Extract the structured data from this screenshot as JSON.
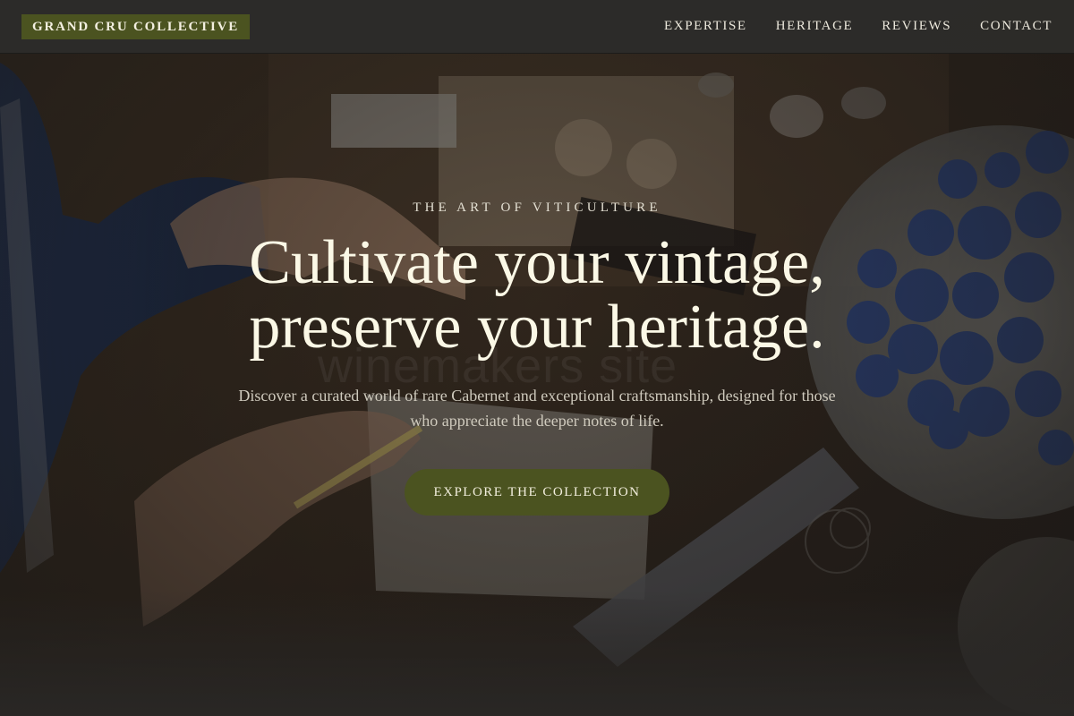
{
  "brand": {
    "logo_text": "GRAND CRU COLLECTIVE",
    "accent_color": "#4b5320"
  },
  "nav": {
    "items": [
      {
        "label": "EXPERTISE"
      },
      {
        "label": "HERITAGE"
      },
      {
        "label": "REVIEWS"
      },
      {
        "label": "CONTACT"
      }
    ]
  },
  "hero": {
    "eyebrow": "THE ART OF VITICULTURE",
    "headline_line1": "Cultivate your vintage,",
    "headline_line2": "preserve your heritage.",
    "subtext_line1": "Discover a curated world of rare Cabernet and exceptional craftsmanship, designed for those",
    "subtext_line2": "who appreciate the deeper notes of life.",
    "cta_label": "EXPLORE THE COLLECTION",
    "background_image": "artisan workbench with hands, paper, tools and a plate of blue clay rosettes",
    "watermark_text": "winemakers site"
  }
}
